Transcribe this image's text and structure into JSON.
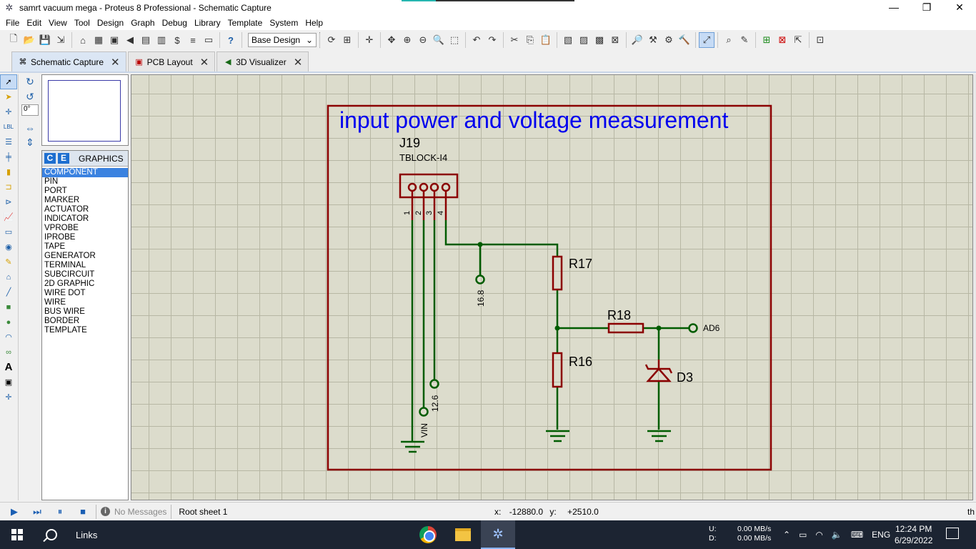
{
  "window": {
    "title": "samrt vacuum mega - Proteus 8 Professional - Schematic Capture",
    "controls": {
      "minimize": "—",
      "maximize": "❐",
      "close": "✕"
    }
  },
  "menu": [
    "File",
    "Edit",
    "View",
    "Tool",
    "Design",
    "Graph",
    "Debug",
    "Library",
    "Template",
    "System",
    "Help"
  ],
  "toolbar": {
    "design_select": "Base Design"
  },
  "tabs": [
    {
      "label": "Schematic Capture",
      "active": true
    },
    {
      "label": "PCB Layout",
      "active": false
    },
    {
      "label": "3D Visualizer",
      "active": false
    }
  ],
  "rotation": {
    "angle": "0°"
  },
  "object_selector": {
    "btn_c": "C",
    "btn_e": "E",
    "title": "GRAPHICS",
    "items": [
      "COMPONENT",
      "PIN",
      "PORT",
      "MARKER",
      "ACTUATOR",
      "INDICATOR",
      "VPROBE",
      "IPROBE",
      "TAPE",
      "GENERATOR",
      "TERMINAL",
      "SUBCIRCUIT",
      "2D GRAPHIC",
      "WIRE DOT",
      "WIRE",
      "BUS WIRE",
      "BORDER",
      "TEMPLATE"
    ],
    "selected": "COMPONENT"
  },
  "schematic": {
    "heading": "input power and voltage measurement",
    "connector_ref": "J19",
    "connector_type": "TBLOCK-I4",
    "pins": [
      "1",
      "2",
      "3",
      "4"
    ],
    "r17": "R17",
    "r18": "R18",
    "r16": "R16",
    "d3": "D3",
    "ad6": "AD6",
    "probe_16_8": "16.8",
    "probe_12_6": "12.6",
    "vin": "VIN",
    "colors": {
      "wire": "#005c00",
      "component": "#8b0000",
      "heading": "#0000ee"
    }
  },
  "status": {
    "messages": "No Messages",
    "sheet": "Root sheet 1",
    "x_label": "x:",
    "x_value": "-12880.0",
    "y_label": "y:",
    "y_value": "+2510.0",
    "right_text": "th"
  },
  "taskbar": {
    "search": "Links",
    "net_u_label": "U:",
    "net_d_label": "D:",
    "net_u": "0.00 MB/s",
    "net_d": "0.00 MB/s",
    "lang": "ENG",
    "time": "12:24 PM",
    "date": "6/29/2022"
  }
}
